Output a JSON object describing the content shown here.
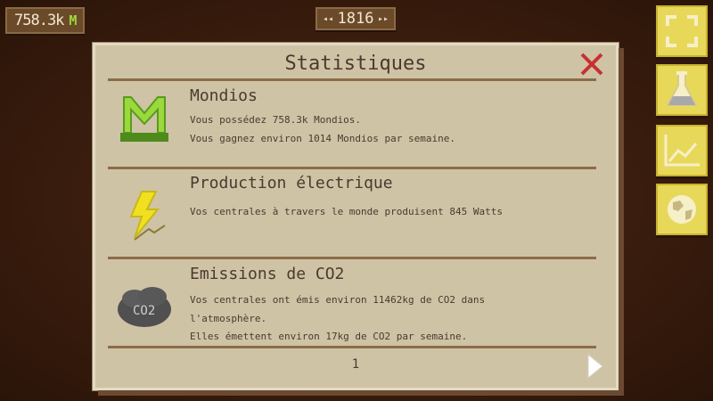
{
  "hud": {
    "money": "758.3k",
    "money_unit": "M",
    "year": "1816"
  },
  "side_buttons": [
    "fullscreen-icon",
    "flask-icon",
    "chart-icon",
    "globe-icon"
  ],
  "panel": {
    "title": "Statistiques",
    "rows": [
      {
        "title": "Mondios",
        "line1": "Vous possédez 758.3k Mondios.",
        "line2": "Vous gagnez environ 1014 Mondios par semaine."
      },
      {
        "title": "Production électrique",
        "line1": "Vos centrales à travers le monde produisent 845 Watts"
      },
      {
        "title": "Emissions de CO2",
        "line1": "Vos centrales ont émis environ 11462kg de CO2 dans",
        "line2": "l'atmosphère.",
        "line3": "Elles émettent environ 17kg de CO2 par semaine."
      }
    ],
    "page": "1",
    "co2_label": "CO2"
  },
  "colors": {
    "background": "#3a1f10",
    "panel": "#cfc3a6",
    "side_button": "#e8d85a",
    "close": "#c83030",
    "mondio_green": "#9ad93b"
  }
}
